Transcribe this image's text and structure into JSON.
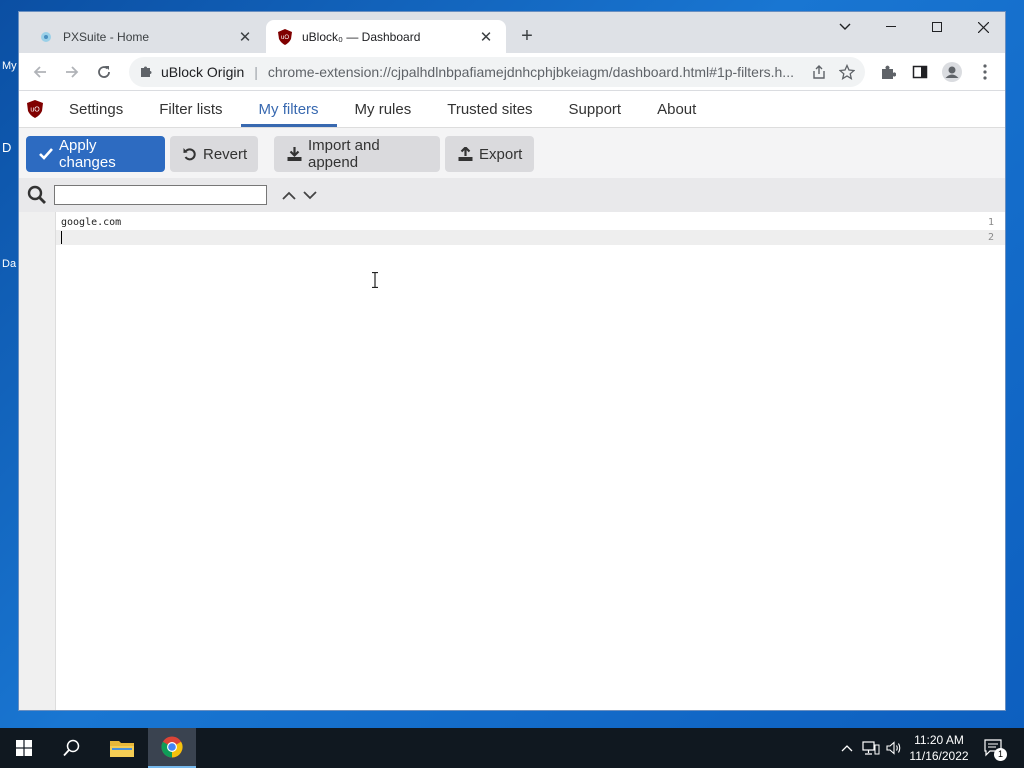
{
  "desktop": {
    "labels": [
      "My",
      "D",
      "Da"
    ]
  },
  "browser": {
    "tabs": [
      {
        "title": "PXSuite - Home",
        "icon": "pxsuite-favicon",
        "active": false
      },
      {
        "title": "uBlock₀ — Dashboard",
        "icon": "ublock-favicon",
        "active": true
      }
    ],
    "omnibox": {
      "origin": "uBlock Origin",
      "url": "chrome-extension://cjpalhdlnbpafiamejdnhcphjbkeiagm/dashboard.html#1p-filters.h..."
    }
  },
  "dashboard": {
    "nav": [
      {
        "label": "Settings"
      },
      {
        "label": "Filter lists"
      },
      {
        "label": "My filters",
        "active": true
      },
      {
        "label": "My rules"
      },
      {
        "label": "Trusted sites"
      },
      {
        "label": "Support"
      },
      {
        "label": "About"
      }
    ],
    "actions": {
      "apply": "Apply changes",
      "revert": "Revert",
      "import": "Import and append",
      "export": "Export"
    },
    "search": {
      "value": "",
      "placeholder": ""
    },
    "editor": {
      "lines": [
        {
          "number": "1",
          "text": "google.com"
        },
        {
          "number": "2",
          "text": ""
        }
      ]
    }
  },
  "taskbar": {
    "time": "11:20 AM",
    "date": "11/16/2022",
    "notifications": "1"
  },
  "colors": {
    "accent": "#2d6bc1",
    "active_tab_text": "#3869b0",
    "ublock_red": "#800000",
    "taskbar": "#101820"
  }
}
